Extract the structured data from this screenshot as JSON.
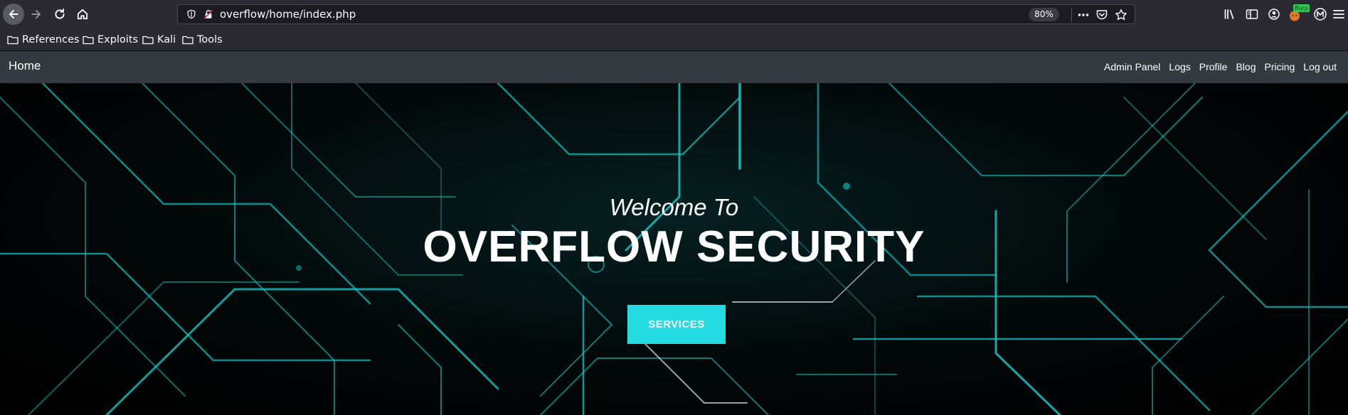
{
  "browser": {
    "url": "overflow/home/index.php",
    "zoom": "80%",
    "bookmarks": [
      {
        "label": "References"
      },
      {
        "label": "Exploits"
      },
      {
        "label": "Kali"
      },
      {
        "label": "Tools"
      }
    ],
    "burp_badge": "Burp"
  },
  "site": {
    "brand": "Home",
    "nav_links": [
      "Admin Panel",
      "Logs",
      "Profile",
      "Blog",
      "Pricing",
      "Log out"
    ]
  },
  "hero": {
    "welcome": "Welcome To",
    "title": "OVERFLOW SECURITY",
    "cta_label": "SERVICES"
  },
  "colors": {
    "chrome_bg": "#2b2a33",
    "navbar_bg": "#343a40",
    "accent_cyan": "#23dbe0"
  }
}
